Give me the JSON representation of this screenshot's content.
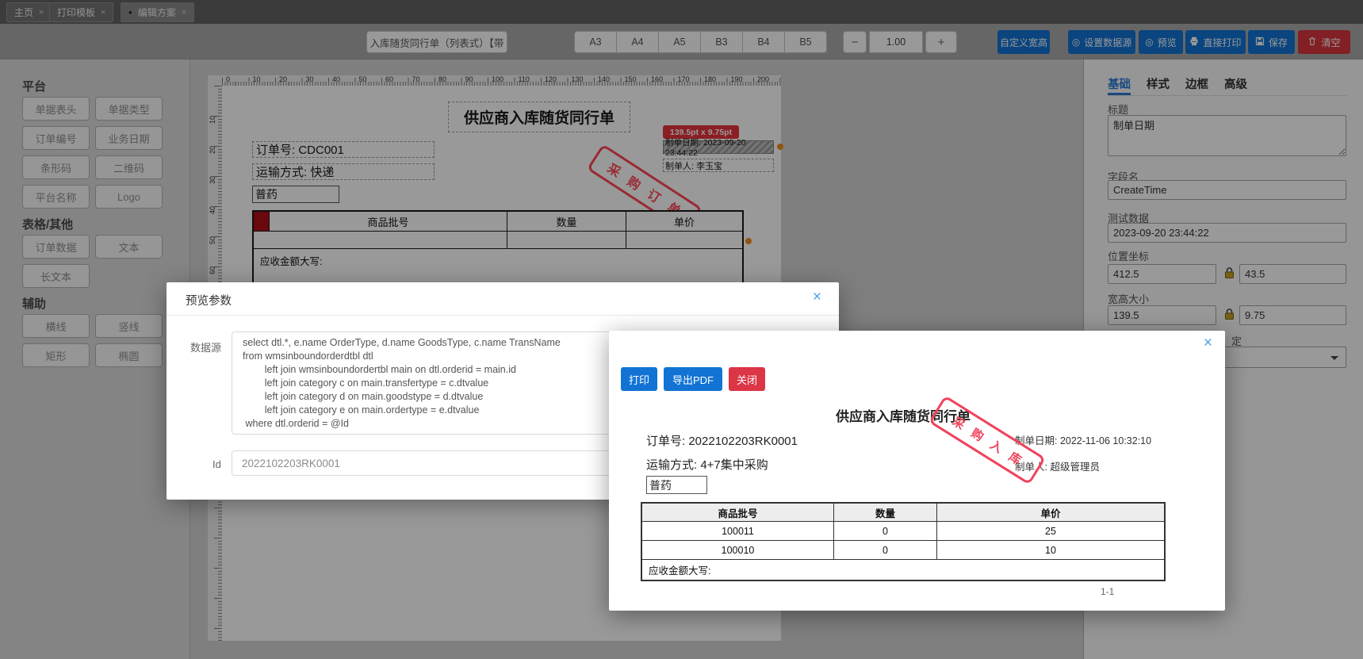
{
  "colors": {
    "primary": "#1273d4",
    "danger": "#dc3545",
    "stamp_red": "#f0435c",
    "selection_tooltip": "#e8323c",
    "handle_orange": "#f08c1a",
    "table_mark_red": "#b01018"
  },
  "tabs": [
    {
      "label": "主页",
      "close": "×"
    },
    {
      "label": "打印模板",
      "close": "×"
    },
    {
      "label": "编辑方案",
      "close": "×",
      "dot": "●"
    }
  ],
  "toolbar": {
    "template_select": "入库随货同行单（列表式）【带",
    "paper_sizes": [
      "A3",
      "A4",
      "A5",
      "B3",
      "B4",
      "B5"
    ],
    "zoom": {
      "minus": "−",
      "value": "1.00",
      "plus": "+"
    },
    "custom_size": "自定义宽高",
    "set_datasource": "设置数据源",
    "preview": "预览",
    "direct_print": "直接打印",
    "save": "保存",
    "clear": "清空",
    "eye_glyph": "◎"
  },
  "sidebar": {
    "sections": [
      {
        "title": "平台",
        "items": [
          "单据表头",
          "单据类型",
          "订单编号",
          "业务日期",
          "条形码",
          "二维码",
          "平台名称",
          "Logo"
        ]
      },
      {
        "title": "表格/其他",
        "items": [
          "订单数据",
          "文本",
          "长文本"
        ]
      },
      {
        "title": "辅助",
        "items": [
          "横线",
          "竖线",
          "矩形",
          "椭圆"
        ]
      }
    ]
  },
  "canvas": {
    "ruler_h": {
      "start": 0,
      "end": 200,
      "step": 10,
      "offset": 5,
      "spacing": 33.5
    },
    "ruler_v": {
      "start": 10,
      "end": 60,
      "step": 10,
      "offset": 38,
      "spacing": 38
    },
    "doc": {
      "title": "供应商入库随货同行单",
      "order_no": "订单号: CDC001",
      "transport": "运输方式: 快递",
      "drug_type": "普药",
      "size_tooltip": "139.5pt x 9.75pt",
      "make_date": "制单日期: 2023-09-20 23:44:22",
      "maker": "制单人: 李玉宝",
      "stamp": "采购订单",
      "table": {
        "headers": [
          "商品批号",
          "数量",
          "单价"
        ],
        "footer": "应收金额大写:"
      }
    }
  },
  "panel": {
    "tabs": [
      "基础",
      "样式",
      "边框",
      "高级"
    ],
    "title_label": "标题",
    "title_value": "制单日期",
    "field_label": "字段名",
    "field_value": "CreateTime",
    "test_label": "测试数据",
    "test_value": "2023-09-20 23:44:22",
    "pos_label": "位置坐标",
    "pos_x": "412.5",
    "pos_y": "43.5",
    "size_label": "宽高大小",
    "size_w": "139.5",
    "size_h": "9.75",
    "partial_label": "定"
  },
  "modal_preview_params": {
    "title": "预览参数",
    "close": "×",
    "datasource_label": "数据源",
    "datasource_sql": "select dtl.*, e.name OrderType, d.name GoodsType, c.name TransName\nfrom wmsinboundorderdtbl dtl\n        left join wmsinboundordertbl main on dtl.orderid = main.id\n        left join category c on main.transfertype = c.dtvalue\n        left join category d on main.goodstype = d.dtvalue\n        left join category e on main.ordertype = e.dtvalue\n where dtl.orderid = @Id",
    "id_label": "Id",
    "id_value": "2022102203RK0001"
  },
  "modal_print_preview": {
    "close": "×",
    "print": "打印",
    "export_pdf": "导出PDF",
    "close_btn": "关闭",
    "doc": {
      "title": "供应商入库随货同行单",
      "order_no": "订单号: 2022102203RK0001",
      "make_date": "制单日期: 2022-11-06 10:32:10",
      "transport": "运输方式: 4+7集中采购",
      "maker": "制单人: 超级管理员",
      "drug_type": "普药",
      "stamp": "采购入库",
      "table": {
        "headers": [
          "商品批号",
          "数量",
          "单价"
        ],
        "rows": [
          [
            "100011",
            "0",
            "25"
          ],
          [
            "100010",
            "0",
            "10"
          ]
        ],
        "footer": "应收金额大写:"
      },
      "page": "1-1"
    }
  }
}
